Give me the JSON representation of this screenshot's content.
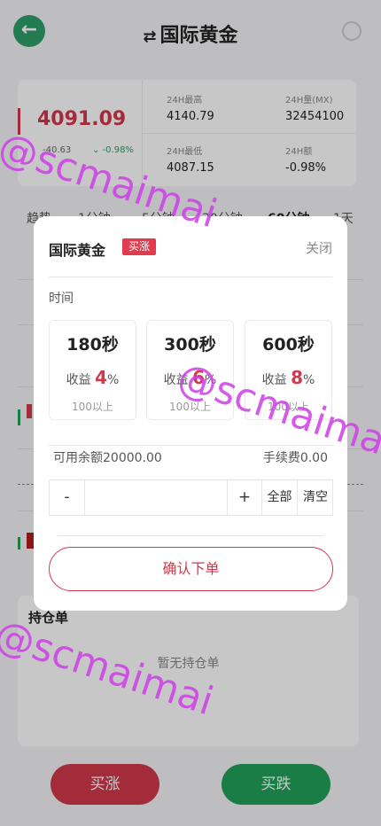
{
  "header": {
    "title": "国际黄金",
    "swap_icon": "⇄"
  },
  "stats": {
    "price": "4091.09",
    "sub_price": "-40.63",
    "sub_change": "-0.98%",
    "high_label": "24H最高",
    "high_value": "4140.79",
    "volume_label": "24H量(MX)",
    "volume_value": "32454100",
    "low_label": "24H最低",
    "low_value": "4087.15",
    "change_label": "24H额",
    "change_value": "-0.98%"
  },
  "tabs": [
    "趋势",
    "1分钟",
    "5分钟",
    "30分钟",
    "60分钟",
    "1天"
  ],
  "positions": {
    "title": "持仓单",
    "empty": "暂无持仓单"
  },
  "bottom": {
    "buy_up": "买涨",
    "buy_down": "买跌"
  },
  "modal": {
    "title": "国际黄金",
    "tag": "买涨",
    "close": "关闭",
    "time_label": "时间",
    "options": [
      {
        "duration": "180秒",
        "yield_label": "收益",
        "yield_pct": "4",
        "pct_sign": "%",
        "min": "100以上"
      },
      {
        "duration": "300秒",
        "yield_label": "收益",
        "yield_pct": "6",
        "pct_sign": "%",
        "min": "100以上"
      },
      {
        "duration": "600秒",
        "yield_label": "收益",
        "yield_pct": "8",
        "pct_sign": "%",
        "min": "100以上"
      }
    ],
    "balance": "可用余额20000.00",
    "fee": "手续费0.00",
    "minus": "-",
    "plus": "+",
    "all": "全部",
    "clear": "清空",
    "quantity_value": "",
    "confirm": "确认下单"
  },
  "watermark": "@scmaimai",
  "colors": {
    "up": "#d1394c",
    "down": "#22a05a",
    "accent_green": "#2e9e6a",
    "tag": "#e23a4e",
    "watermark": "#cc3ee6"
  }
}
